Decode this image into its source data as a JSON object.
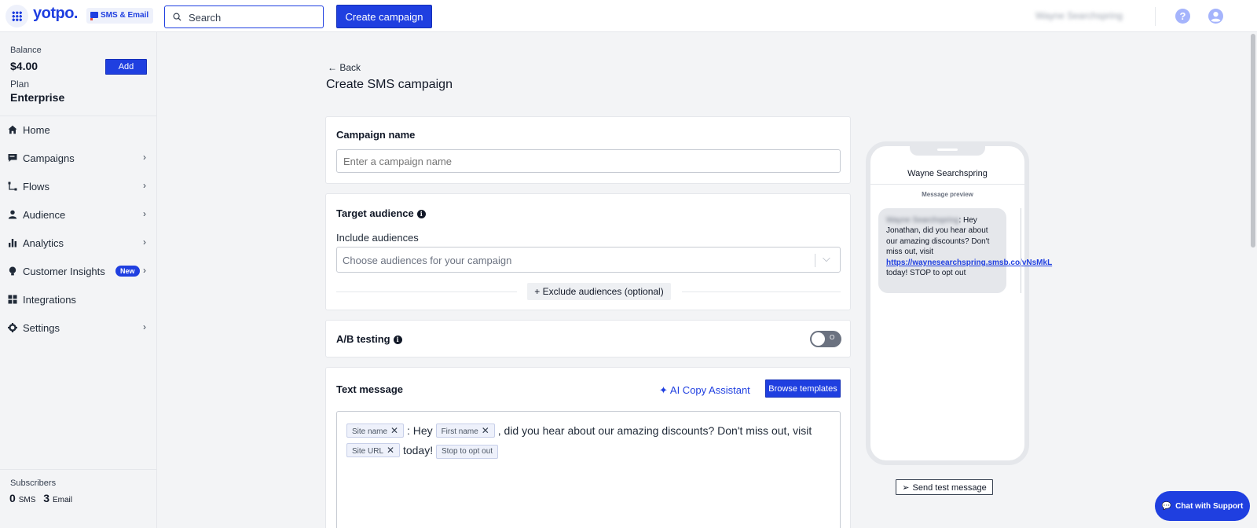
{
  "topbar": {
    "logo": "yotpo.",
    "product_badge": "SMS & Email",
    "search_placeholder": "Search",
    "create_campaign_label": "Create campaign",
    "account_name": "Wayne Searchspring"
  },
  "sidebar": {
    "balance_label": "Balance",
    "balance_value": "$4.00",
    "add_label": "Add",
    "plan_label": "Plan",
    "plan_value": "Enterprise",
    "nav": [
      {
        "label": "Home",
        "icon": "home-icon"
      },
      {
        "label": "Campaigns",
        "icon": "message-icon"
      },
      {
        "label": "Flows",
        "icon": "flow-icon"
      },
      {
        "label": "Audience",
        "icon": "person-icon"
      },
      {
        "label": "Analytics",
        "icon": "bar-chart-icon"
      },
      {
        "label": "Customer Insights",
        "icon": "bulb-icon",
        "badge": "New"
      },
      {
        "label": "Integrations",
        "icon": "grid-icon"
      },
      {
        "label": "Settings",
        "icon": "gear-icon"
      }
    ],
    "subscribers_label": "Subscribers",
    "sms_count": "0",
    "sms_label": "SMS",
    "email_count": "3",
    "email_label": "Email"
  },
  "main": {
    "back_label": "Back",
    "page_title": "Create SMS campaign",
    "campaign_name": {
      "title": "Campaign name",
      "placeholder": "Enter a campaign name",
      "value": ""
    },
    "target_audience": {
      "title": "Target audience",
      "include_label": "Include audiences",
      "include_placeholder": "Choose audiences for your campaign",
      "exclude_label": "+ Exclude audiences (optional)"
    },
    "ab_testing": {
      "title": "A/B testing",
      "toggle_state": "O"
    },
    "text_message": {
      "title": "Text message",
      "ai_label": "AI Copy Assistant",
      "browse_label": "Browse templates",
      "chip_site_name": "Site name",
      "text_1": ": Hey",
      "chip_first_name": "First name",
      "text_2": ", did you hear about our amazing discounts? Don't miss out, visit",
      "chip_site_url": "Site URL",
      "text_3": "today!",
      "chip_stop": "Stop to opt out"
    }
  },
  "preview": {
    "contact_name": "Wayne Searchspring",
    "label": "Message preview",
    "sender_blurred": "Wayne Searchspring",
    "message_before_link": ": Hey Jonathan, did you hear about our amazing discounts? Don't miss out, visit ",
    "link": "https://waynesearchspring.smsb.co/vNsMkL",
    "message_after_link": " today! STOP to opt out",
    "send_test_label": "Send test message"
  },
  "chat_support_label": "Chat with Support",
  "colors": {
    "brand_blue": "#1f3fe0",
    "toggle_off": "#6b7280"
  }
}
